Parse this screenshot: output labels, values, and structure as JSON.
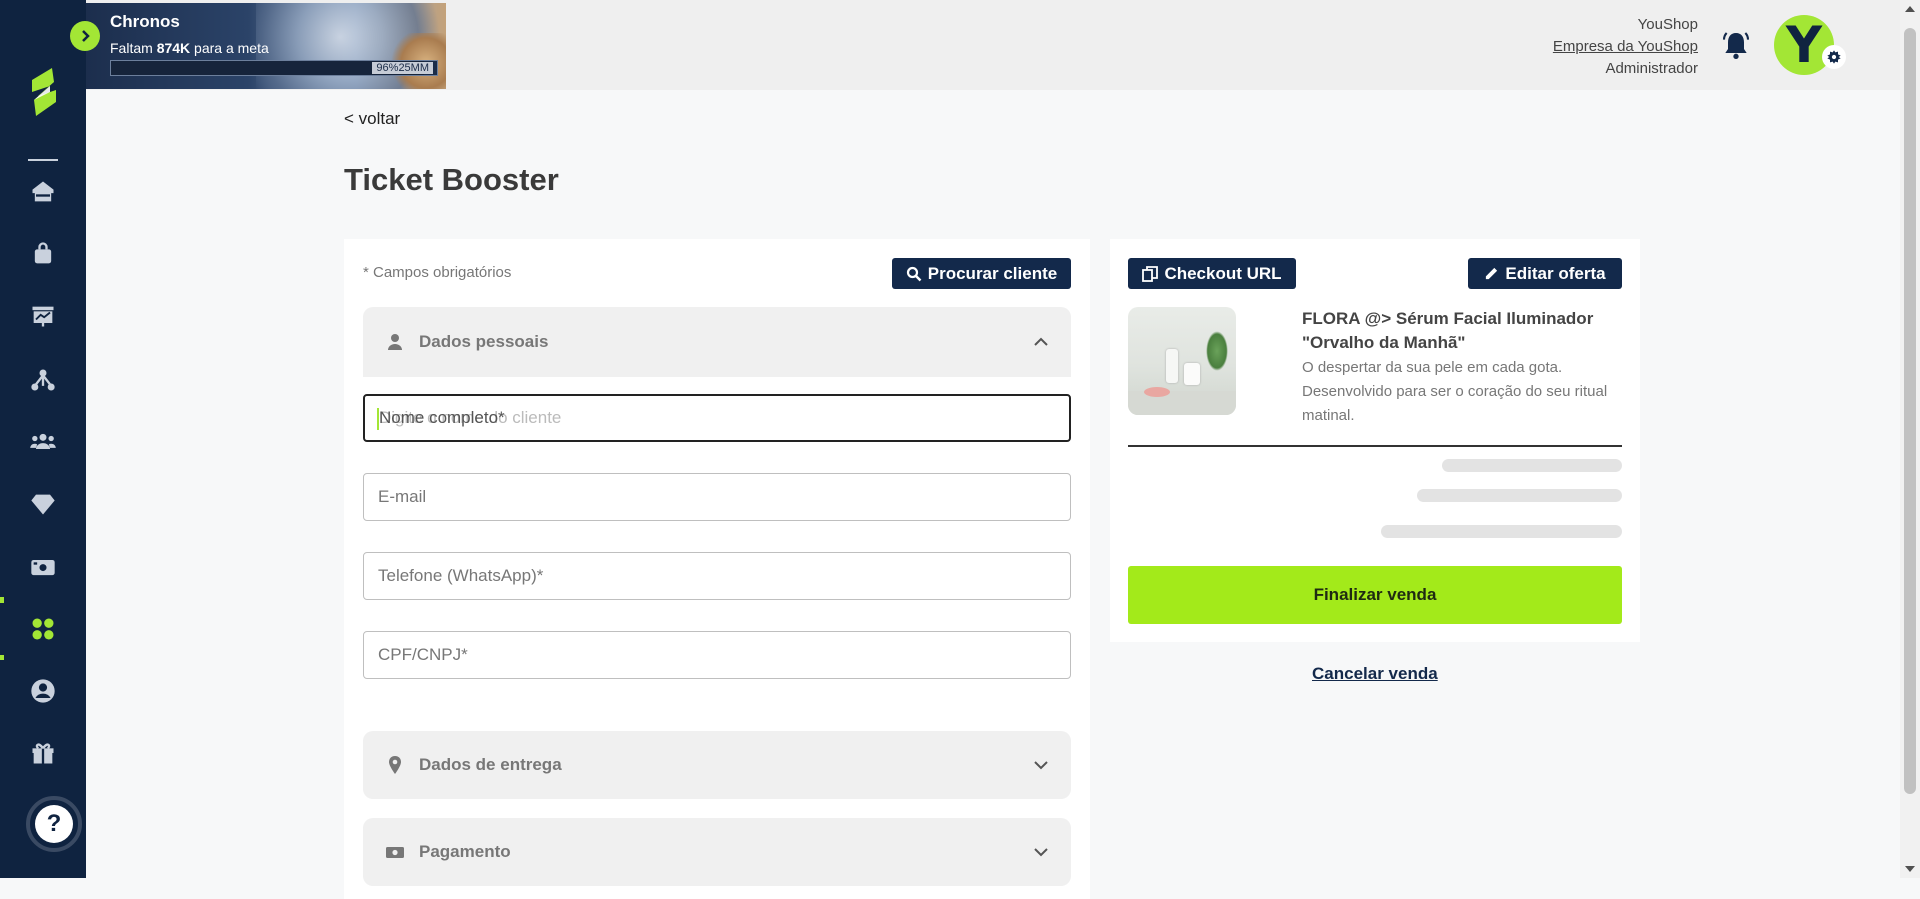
{
  "banner": {
    "title": "Chronos",
    "subtitle_prefix": "Faltam ",
    "subtitle_amount": "874K",
    "subtitle_suffix": " para a meta",
    "progress_label": "96%25MM",
    "progress_fraction": 0.96
  },
  "user": {
    "store": "YouShop",
    "company": "Empresa da YouShop",
    "role": "Administrador",
    "avatar_letter": "Y"
  },
  "sidebar": {
    "items": [
      {
        "icon": "home-icon"
      },
      {
        "icon": "bag-icon"
      },
      {
        "icon": "chart-board-icon"
      },
      {
        "icon": "network-icon"
      },
      {
        "icon": "users-icon"
      },
      {
        "icon": "diamond-icon"
      },
      {
        "icon": "cash-icon"
      },
      {
        "icon": "apps-grid-icon",
        "active": true
      },
      {
        "icon": "user-circle-icon"
      },
      {
        "icon": "gift-icon"
      }
    ],
    "help_label": "?"
  },
  "page": {
    "back_label": "< voltar",
    "title": "Ticket Booster"
  },
  "form": {
    "required_note": "* Campos obrigatórios",
    "search_client_label": "Procurar cliente",
    "sections": {
      "personal": "Dados pessoais",
      "delivery": "Dados de entrega",
      "payment": "Pagamento"
    },
    "fields": {
      "name_label": "Nome completo*",
      "name_placeholder": "Digite o nome do cliente",
      "email_label": "E-mail",
      "phone_label": "Telefone (WhatsApp)*",
      "document_label": "CPF/CNPJ*"
    }
  },
  "offer": {
    "checkout_url_label": "Checkout URL",
    "edit_offer_label": "Editar oferta",
    "product_name": "FLORA @> Sérum Facial Iluminador \"Orvalho da Manhã\"",
    "product_description": "O despertar da sua pele em cada gota. Desenvolvido para ser o coração do seu ritual matinal.",
    "finalize_label": "Finalizar venda",
    "cancel_label": "Cancelar venda"
  },
  "colors": {
    "navy": "#13294b",
    "sidebar": "#0f2340",
    "accent_green": "#a3ea1a"
  }
}
